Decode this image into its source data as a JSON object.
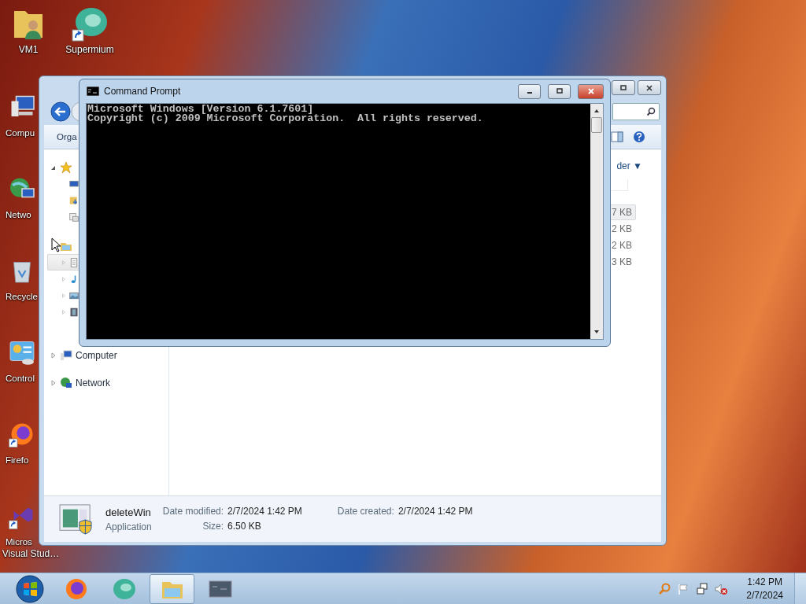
{
  "desktop": {
    "icons": [
      {
        "label": "VM1",
        "kind": "user-folder",
        "shortcut": false
      },
      {
        "label": "Supermium",
        "kind": "supermium",
        "shortcut": true
      },
      {
        "label": "Compu",
        "kind": "computer",
        "shortcut": false
      },
      {
        "label": "Netwo",
        "kind": "network",
        "shortcut": false
      },
      {
        "label": "Recycle",
        "kind": "recycle-bin",
        "shortcut": false
      },
      {
        "label": "Control",
        "kind": "control-panel",
        "shortcut": false
      },
      {
        "label": "Firefo",
        "kind": "firefox",
        "shortcut": true
      },
      {
        "label": "Micros",
        "label_2": "Visual Stud…",
        "kind": "visual-studio",
        "shortcut": true
      }
    ]
  },
  "explorer": {
    "organize": "Orga",
    "arrange_by": "der ▼",
    "nav_tree": [
      {
        "kind": "favorites",
        "expanded": true,
        "children": [
          {
            "kind": "desktop"
          },
          {
            "kind": "downloads"
          },
          {
            "kind": "recent"
          }
        ]
      },
      {
        "kind": "libraries",
        "expanded": true,
        "children": [
          {
            "kind": "documents",
            "expanded": false,
            "selected": true
          },
          {
            "kind": "music",
            "expanded": false,
            "selected": false
          },
          {
            "kind": "pictures",
            "expanded": false,
            "selected": false
          },
          {
            "kind": "videos",
            "expanded": false,
            "selected": false
          }
        ]
      },
      {
        "kind": "computer",
        "label": "Computer",
        "expanded": false
      },
      {
        "kind": "network",
        "label": "Network",
        "expanded": false
      }
    ],
    "files": [
      {
        "size": "7 KB",
        "selected": true
      },
      {
        "size": "2 KB",
        "selected": false
      },
      {
        "size": "2 KB",
        "selected": false
      },
      {
        "size": "3 KB",
        "selected": false
      }
    ],
    "details": {
      "name": "deleteWin",
      "type": "Application",
      "fields": [
        {
          "label": "Date modified:",
          "value": "2/7/2024 1:42 PM"
        },
        {
          "label": "Size:",
          "value": "6.50 KB"
        },
        {
          "label": "Date created:",
          "value": "2/7/2024 1:42 PM"
        }
      ]
    }
  },
  "cmd": {
    "title": "Command Prompt",
    "lines": [
      "Microsoft Windows [Version 6.1.7601]",
      "Copyright (c) 2009 Microsoft Corporation.  All rights reserved."
    ]
  },
  "taskbar": {
    "items": [
      {
        "kind": "firefox",
        "selected": false
      },
      {
        "kind": "supermium",
        "selected": false
      },
      {
        "kind": "explorer",
        "selected": true
      },
      {
        "kind": "cmd",
        "selected": false
      }
    ],
    "time": "1:42 PM",
    "date": "2/7/2024"
  }
}
